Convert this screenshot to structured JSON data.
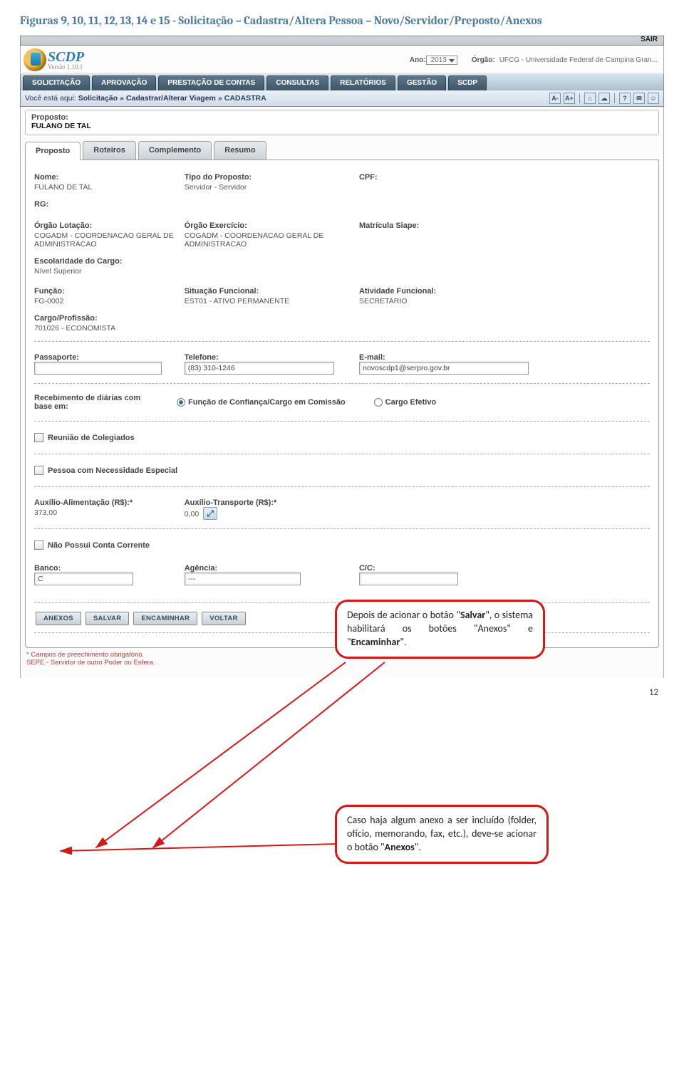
{
  "heading": "Figuras 9, 10, 11, 12, 13, 14 e 15 - Solicitação – Cadastra/Altera Pessoa – Novo/Servidor/Preposto/Anexos",
  "topbar": {
    "sair": "SAIR"
  },
  "header": {
    "logo": "SCDP",
    "versao": "Versão 1.10.1",
    "ano_lbl": "Ano:",
    "ano_val": "2013",
    "orgao_lbl": "Órgão:",
    "orgao_val": "UFCG - Universidade Federal de Campina Gran..."
  },
  "nav": [
    "SOLICITAÇÃO",
    "APROVAÇÃO",
    "PRESTAÇÃO DE CONTAS",
    "CONSULTAS",
    "RELATÓRIOS",
    "GESTÃO",
    "SCDP"
  ],
  "breadcrumb": {
    "pre": "Você está aqui:",
    "p1": "Solicitação",
    "p2": "Cadastrar/Alterar Viagem",
    "cur": "CADASTRA"
  },
  "proposto": {
    "lbl": "Proposto:",
    "nome": "FULANO DE TAL"
  },
  "tabs": [
    "Proposto",
    "Roteiros",
    "Complemento",
    "Resumo"
  ],
  "form": {
    "r1": {
      "nome_lbl": "Nome:",
      "nome_val": "FULANO DE TAL",
      "tipo_lbl": "Tipo do Proposto:",
      "tipo_val": "Servidor - Servidor",
      "cpf_lbl": "CPF:",
      "cpf_val": "",
      "rg_lbl": "RG:",
      "rg_val": ""
    },
    "r2": {
      "ol_lbl": "Órgão Lotação:",
      "ol_val": "COGADM - COORDENACAO GERAL DE ADMINISTRACAO",
      "oe_lbl": "Órgão Exercício:",
      "oe_val": "COGADM - COORDENACAO GERAL DE ADMINISTRACAO",
      "ms_lbl": "Matrícula Siape:",
      "ms_val": "",
      "ec_lbl": "Escolaridade do Cargo:",
      "ec_val": "Nível Superior"
    },
    "r3": {
      "fn_lbl": "Função:",
      "fn_val": "FG-0002",
      "sf_lbl": "Situação Funcional:",
      "sf_val": "EST01 - ATIVO PERMANENTE",
      "af_lbl": "Atividade Funcional:",
      "af_val": "SECRETARIO",
      "cp_lbl": "Cargo/Profissão:",
      "cp_val": "701026 - ECONOMISTA"
    },
    "r4": {
      "pp_lbl": "Passaporte:",
      "pp_val": "",
      "tl_lbl": "Telefone:",
      "tl_val": "(83) 310-1246",
      "em_lbl": "E-mail:",
      "em_val": "novoscdp1@serpro.gov.br"
    },
    "diaria": {
      "lbl": "Recebimento de diárias com base em:",
      "op1": "Função de Confiança/Cargo em Comissão",
      "op2": "Cargo Efetivo"
    },
    "chk1": "Reunião de Colegiados",
    "chk2": "Pessoa com Necessidade Especial",
    "aux": {
      "aa_lbl": "Auxílio-Alimentação (R$):*",
      "aa_val": "373,00",
      "at_lbl": "Auxílio-Transporte (R$):*",
      "at_val": "0,00"
    },
    "chk3": "Não Possui Conta Corrente",
    "banco": {
      "bn_lbl": "Banco:",
      "bn_val": "C",
      "ag_lbl": "Agência:",
      "ag_val": "---",
      "cc_lbl": "C/C:",
      "cc_val": ""
    }
  },
  "buttons": [
    "ANEXOS",
    "SALVAR",
    "ENCAMINHAR",
    "VOLTAR"
  ],
  "legend1": "* Campos de preechimento obrigatório.",
  "legend2": "SEPE - Servidor de outro Poder ou Esfera.",
  "callout1_pre": "Depois de acionar o botão \"",
  "callout1_b1": "Salvar",
  "callout1_mid": "\", o sistema habilitará os botões \"Anexos\" e \"",
  "callout1_b2": "Encaminhar",
  "callout1_end": "\".",
  "callout2_pre": "Caso haja algum anexo a ser incluído (folder, ofício, memorando, fax, etc.), deve-se acionar o botão \"",
  "callout2_b": "Anexos",
  "callout2_end": "\".",
  "page_num": "12"
}
